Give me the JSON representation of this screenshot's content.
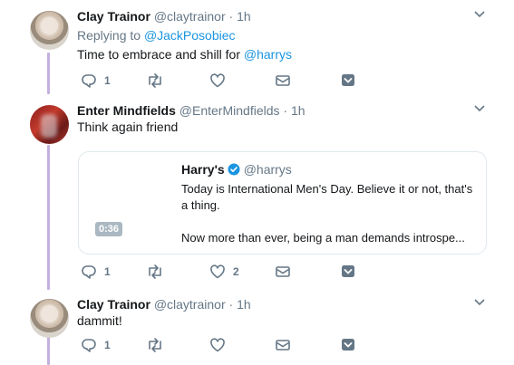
{
  "tweets": [
    {
      "name": "Clay Trainor",
      "handle": "@claytrainor",
      "dot": "·",
      "time": "1h",
      "reply_prefix": "Replying to",
      "reply_to": "@JackPosobiec",
      "text_before": "Time to embrace and shill for ",
      "text_mention": "@harrys",
      "reply_count": "1",
      "retweet_count": "",
      "like_count": ""
    },
    {
      "name": "Enter Mindfields",
      "handle": "@EnterMindfields",
      "dot": "·",
      "time": "1h",
      "text": "Think again friend",
      "quoted": {
        "name": "Harry's",
        "handle": "@harrys",
        "line1": "Today is International Men's Day. Believe it or not, that's a thing.",
        "line2": "Now more than ever, being a man demands introspe...",
        "duration": "0:36"
      },
      "reply_count": "1",
      "retweet_count": "",
      "like_count": "2"
    },
    {
      "name": "Clay Trainor",
      "handle": "@claytrainor",
      "dot": "·",
      "time": "1h",
      "text": "dammit!",
      "reply_count": "1",
      "retweet_count": "",
      "like_count": ""
    }
  ],
  "icons": {
    "reply": "reply-icon",
    "retweet": "retweet-icon",
    "like": "heart-icon",
    "dm": "envelope-icon",
    "save": "bookmark-icon",
    "more": "chevron-down-icon",
    "verified": "verified-badge-icon"
  },
  "colors": {
    "link": "#1b95e0",
    "muted": "#657786",
    "thread_line": "#c4b0df",
    "card_border": "#e1e8ed"
  }
}
